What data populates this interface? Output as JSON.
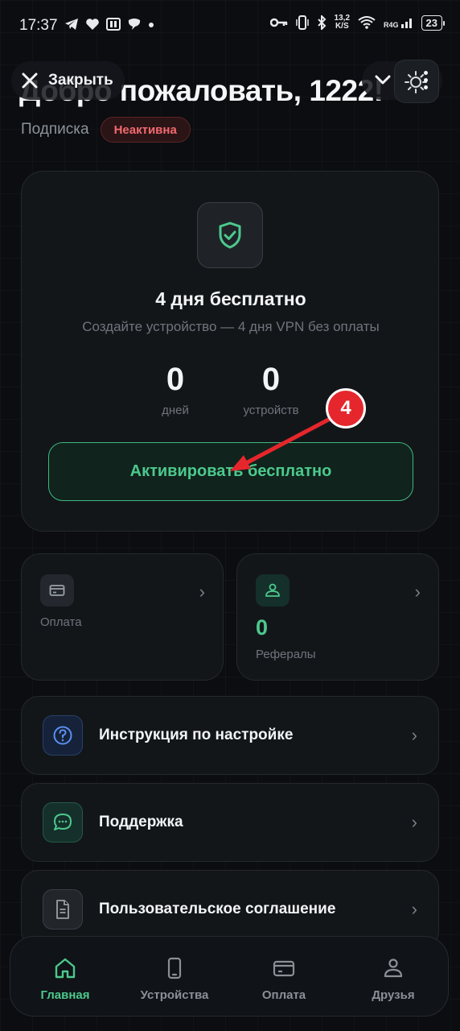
{
  "status_bar": {
    "time": "17:37",
    "net_speed_value": "13,2",
    "net_speed_unit": "K/S",
    "network_type": "R4G",
    "battery": "23"
  },
  "header": {
    "close_label": "Закрыть",
    "welcome": "Добро пожаловать, 1222!",
    "subscription_label": "Подписка",
    "subscription_status": "Неактивна"
  },
  "trial_card": {
    "title": "4 дня бесплатно",
    "subtitle": "Создайте устройство — 4 дня VPN без оплаты",
    "days_value": "0",
    "days_label": "дней",
    "devices_value": "0",
    "devices_label": "устройств",
    "activate_label": "Активировать бесплатно"
  },
  "payment_card": {
    "label": "Оплата"
  },
  "referrals_card": {
    "value": "0",
    "label": "Рефералы"
  },
  "menu": {
    "instructions": "Инструкция по настройке",
    "support": "Поддержка",
    "agreement": "Пользовательское соглашение"
  },
  "bottom_nav": {
    "home": "Главная",
    "devices": "Устройства",
    "payment": "Оплата",
    "friends": "Друзья"
  },
  "annotation": {
    "step_number": "4"
  },
  "colors": {
    "accent_green": "#4cc98d",
    "inactive_red": "#f26a6f",
    "annotation_red": "#e5262c"
  }
}
